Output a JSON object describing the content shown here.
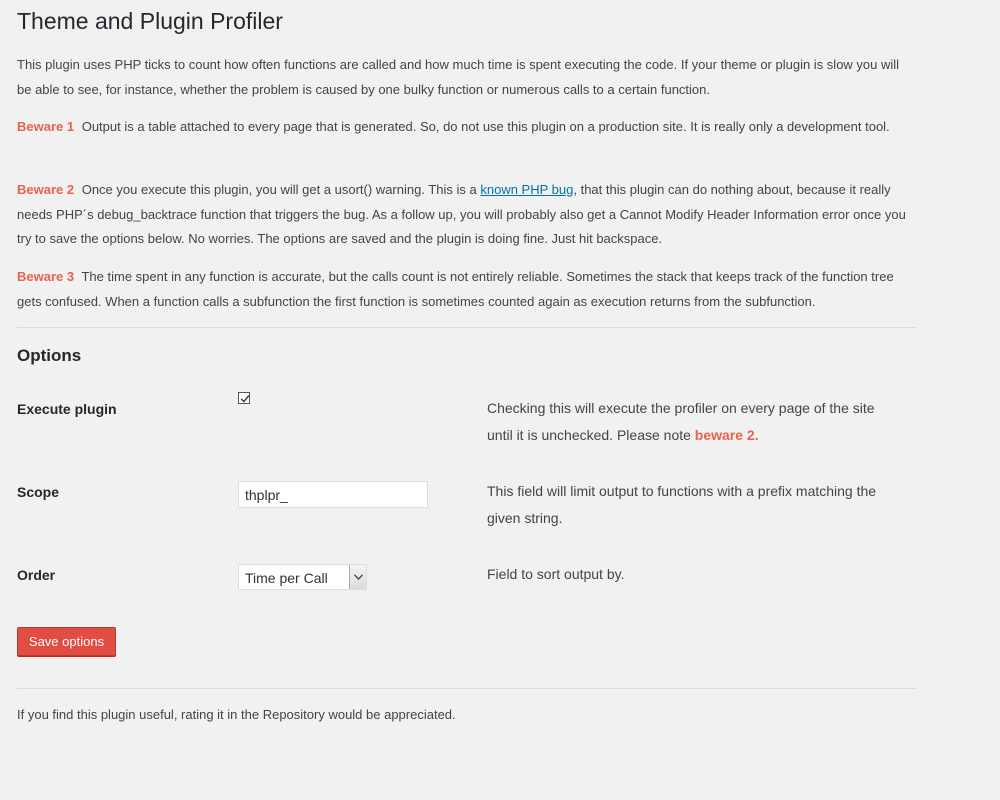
{
  "page_title": "Theme and Plugin Profiler",
  "intro": "This plugin uses PHP ticks to count how often functions are called and how much time is spent executing the code. If your theme or plugin is slow you will be able to see, for instance, whether the problem is caused by one bulky function or numerous calls to a certain function.",
  "beware1": {
    "label": "Beware 1",
    "text": "Output is a table attached to every page that is generated. So, do not use this plugin on a production site. It is really only a development tool."
  },
  "beware2": {
    "label": "Beware 2",
    "text_before": "Once you execute this plugin, you will get a usort() warning. This is a",
    "link": "known PHP bug",
    "text_after": ", that this plugin can do nothing about, because it really needs PHP´s debug_backtrace function that triggers the bug. As a follow up, you will probably also get a Cannot Modify Header Information error once you try to save the options below. No worries. The options are saved and the plugin is doing fine. Just hit backspace."
  },
  "beware3": {
    "label": "Beware 3",
    "text": "The time spent in any function is accurate, but the calls count is not entirely reliable. Sometimes the stack that keeps track of the function tree gets confused. When a function calls a subfunction the first function is sometimes counted again as execution returns from the subfunction."
  },
  "options": {
    "heading": "Options",
    "execute": {
      "label": "Execute plugin",
      "checked": true,
      "desc": "Checking this will execute the profiler on every page of the site until it is unchecked. Please note",
      "desc_highlight": "beware 2."
    },
    "scope": {
      "label": "Scope",
      "value": "thplpr_",
      "desc": "This field will limit output to functions with a prefix matching the given string."
    },
    "order": {
      "label": "Order",
      "selected": "Time per Call",
      "desc": "Field to sort output by."
    },
    "save_label": "Save options"
  },
  "footer": "If you find this plugin useful, rating it in the Repository would be appreciated.",
  "colors": {
    "accent": "#e14d43",
    "beware": "#e8634c",
    "link": "#0073aa",
    "background": "#f1f1f1"
  },
  "icons": {
    "checkbox": "checkmark-icon",
    "select": "chevron-down-icon"
  }
}
